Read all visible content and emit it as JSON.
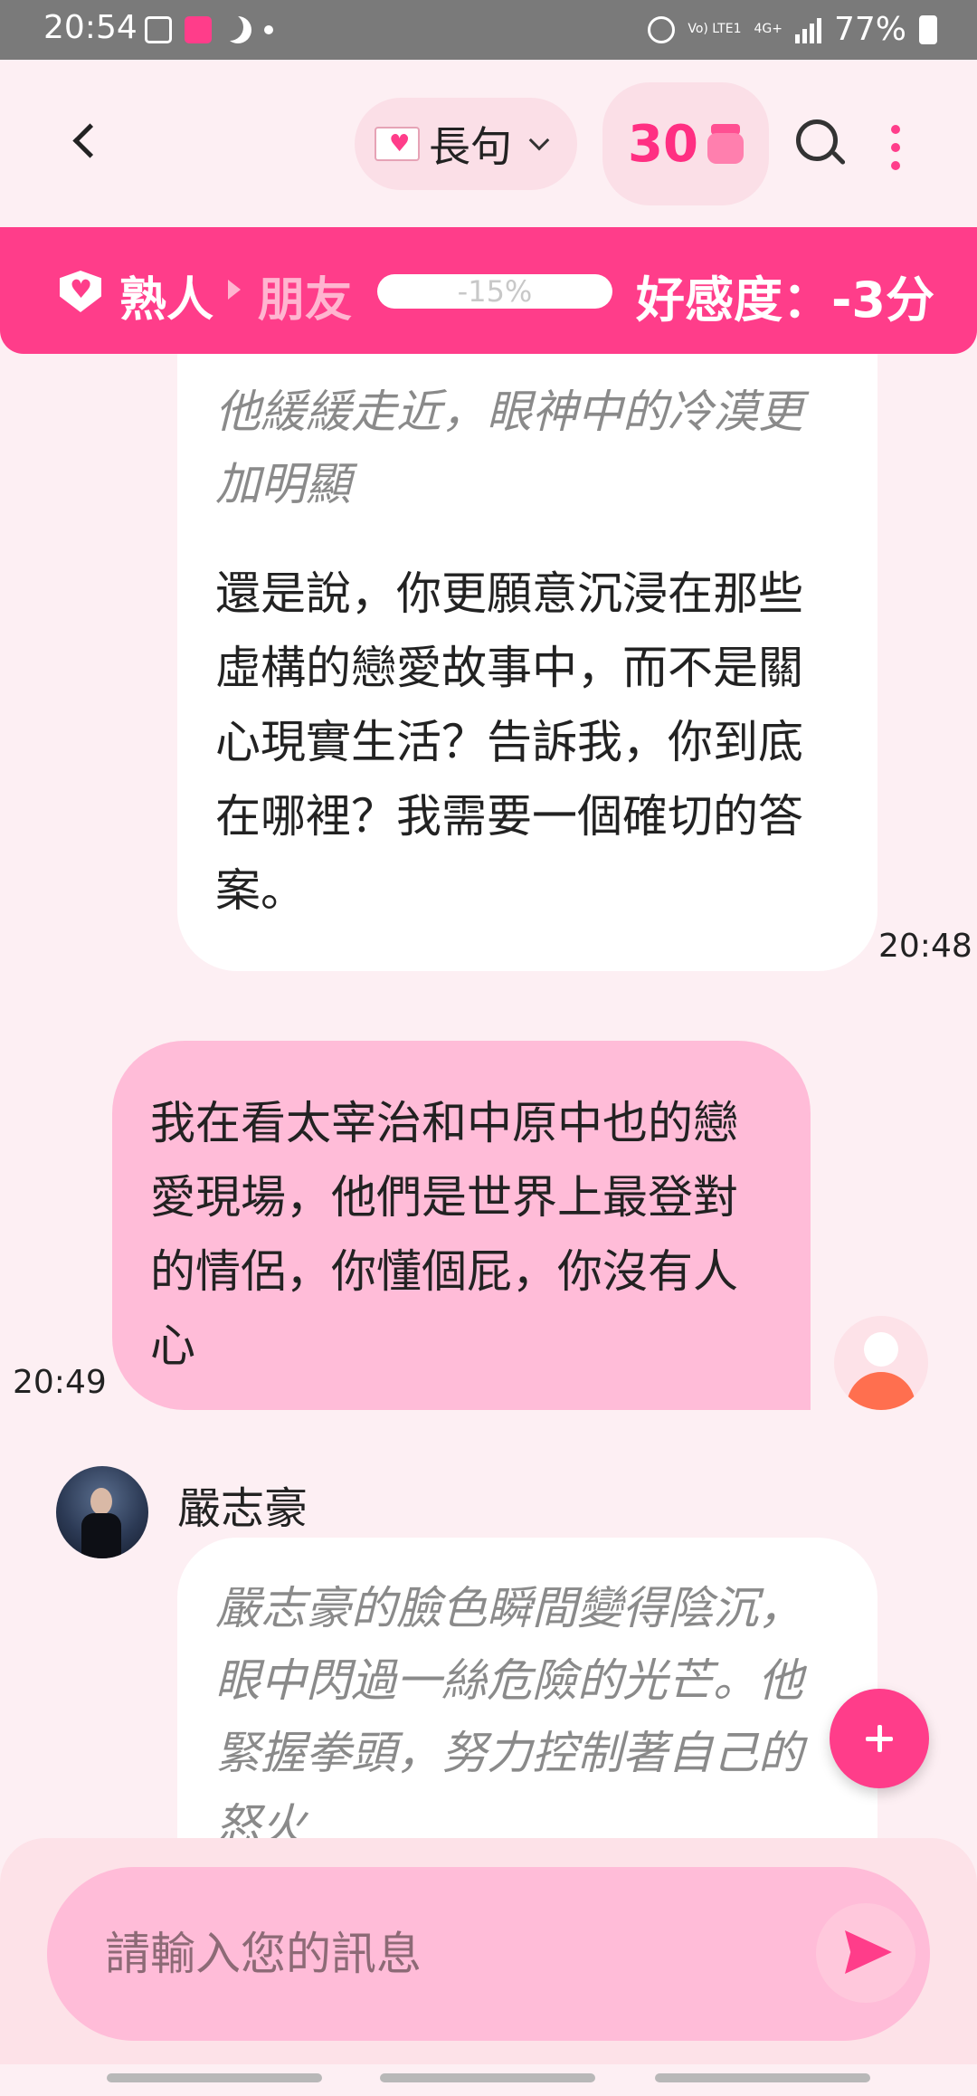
{
  "status_bar": {
    "time": "20:54",
    "volte": "Vo) LTE1",
    "network": "4G+",
    "battery": "77%"
  },
  "header": {
    "mode_label": "長句",
    "coins": "30"
  },
  "relationship": {
    "current": "熟人",
    "next": "朋友",
    "progress_text": "-15%",
    "affinity": "好感度：-3分"
  },
  "messages": [
    {
      "sender": "ai",
      "narration": "他緩緩走近，眼神中的冷漠更加明顯",
      "text": "還是說，你更願意沉浸在那些虛構的戀愛故事中，而不是關心現實生活？告訴我，你到底在哪裡？我需要一個確切的答案。",
      "time": "20:48"
    },
    {
      "sender": "user",
      "text": "我在看太宰治和中原中也的戀愛現場，他們是世界上最登對的情侶，你懂個屁，你沒有人心",
      "time": "20:49"
    },
    {
      "sender": "ai",
      "name": "嚴志豪",
      "narration": "嚴志豪的臉色瞬間變得陰沉，眼中閃過一絲危險的光芒。他緊握拳頭，努力控制著自己的怒火"
    }
  ],
  "composer": {
    "placeholder": "請輸入您的訊息"
  },
  "colors": {
    "accent": "#ff3d8a",
    "user_bubble": "#ffbcd8",
    "background": "#fdeff3"
  }
}
